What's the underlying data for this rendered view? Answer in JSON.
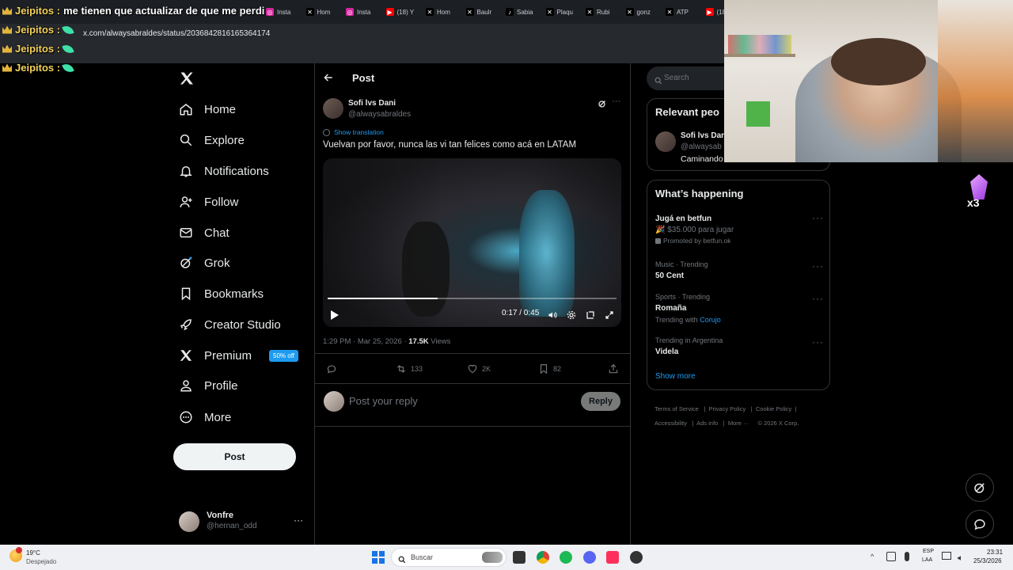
{
  "colors": {
    "accent": "#1d9bf0",
    "background": "#000000",
    "text": "#e7e9ea",
    "muted": "#71767b",
    "overlay_name": "#f3d25a"
  },
  "browser": {
    "tabs": [
      {
        "label": "Insta",
        "icon": "instagram-icon"
      },
      {
        "label": "Hom",
        "icon": "x-icon"
      },
      {
        "label": "Insta",
        "icon": "instagram-icon"
      },
      {
        "label": "(18) Y",
        "icon": "youtube-icon"
      },
      {
        "label": "Hom",
        "icon": "x-icon"
      },
      {
        "label": "Baulr",
        "icon": "x-icon"
      },
      {
        "label": "Sabia",
        "icon": "tiktok-icon"
      },
      {
        "label": "Plaqu",
        "icon": "x-icon"
      },
      {
        "label": "Rubi",
        "icon": "x-icon"
      },
      {
        "label": "gonz",
        "icon": "x-icon"
      },
      {
        "label": "ATP",
        "icon": "x-icon"
      },
      {
        "label": "(18",
        "icon": "youtube-icon"
      }
    ],
    "url": "x.com/alwaysabraldes/status/2036842816165364174"
  },
  "stream_chat": [
    {
      "user": "Jeipitos :",
      "message": "me tienen que actualizar de que me perdi"
    },
    {
      "user": "Jeipitos :",
      "message": ""
    },
    {
      "user": "Jeipitos :",
      "message": ""
    },
    {
      "user": "Jeipitos :",
      "message": ""
    }
  ],
  "nav": {
    "items": [
      {
        "label": "Home",
        "icon": "home-icon"
      },
      {
        "label": "Explore",
        "icon": "search-icon"
      },
      {
        "label": "Notifications",
        "icon": "bell-icon"
      },
      {
        "label": "Follow",
        "icon": "add-person-icon"
      },
      {
        "label": "Chat",
        "icon": "mail-icon"
      },
      {
        "label": "Grok",
        "icon": "grok-icon"
      },
      {
        "label": "Bookmarks",
        "icon": "bookmark-icon"
      },
      {
        "label": "Creator Studio",
        "icon": "rocket-icon"
      },
      {
        "label": "Premium",
        "icon": "x-icon"
      },
      {
        "label": "Profile",
        "icon": "person-icon"
      },
      {
        "label": "More",
        "icon": "more-circle-icon"
      }
    ],
    "premium_badge": "50% off",
    "post_button": "Post",
    "account": {
      "name": "Vonfre",
      "handle": "@hernan_odd"
    }
  },
  "post": {
    "header_title": "Post",
    "author_name": "Sofi lvs Dani",
    "author_handle": "@alwaysabraldes",
    "show_translation": "Show translation",
    "text": "Vuelvan por favor, nunca las vi tan felices como acá en LATAM",
    "video_time": "0:17 / 0:45",
    "video_progress": 0.38,
    "timestamp": "1:29 PM · Mar 25, 2026 · ",
    "views_count": "17.5K",
    "views_label": " Views",
    "reposts": "133",
    "likes": "2K",
    "bookmarks": "82",
    "reply_placeholder": "Post your reply",
    "reply_button": "Reply"
  },
  "right": {
    "search_placeholder": "Search",
    "relevant_title": "Relevant peo",
    "relevant_name": "Sofi lvs Dan",
    "relevant_handle": "@alwaysab",
    "relevant_bio": "Caminando",
    "happening_title": "What’s happening",
    "trends": [
      {
        "meta": "",
        "name": "Jugá en betfun",
        "extra": "🎉 $35.000 para jugar",
        "promoted": "Promoted by betfun.ok"
      },
      {
        "meta": "Music · Trending",
        "name": "50 Cent"
      },
      {
        "meta": "Sports · Trending",
        "name": "Romaña",
        "with_label": "Trending with ",
        "with_link": "Corujo"
      },
      {
        "meta": "Trending in Argentina",
        "name": "Videla"
      }
    ],
    "show_more": "Show more",
    "footer": [
      "Terms of Service",
      "Privacy Policy",
      "Cookie Policy",
      "Accessibility",
      "Ads info",
      "More ···",
      "© 2026 X Corp."
    ]
  },
  "taskbar": {
    "weather_temp": "19°C",
    "weather_desc": "Despejado",
    "search_placeholder": "Buscar",
    "lang_top": "ESP",
    "lang_bottom": "LAA",
    "time": "23:31",
    "date": "25/3/2026"
  }
}
